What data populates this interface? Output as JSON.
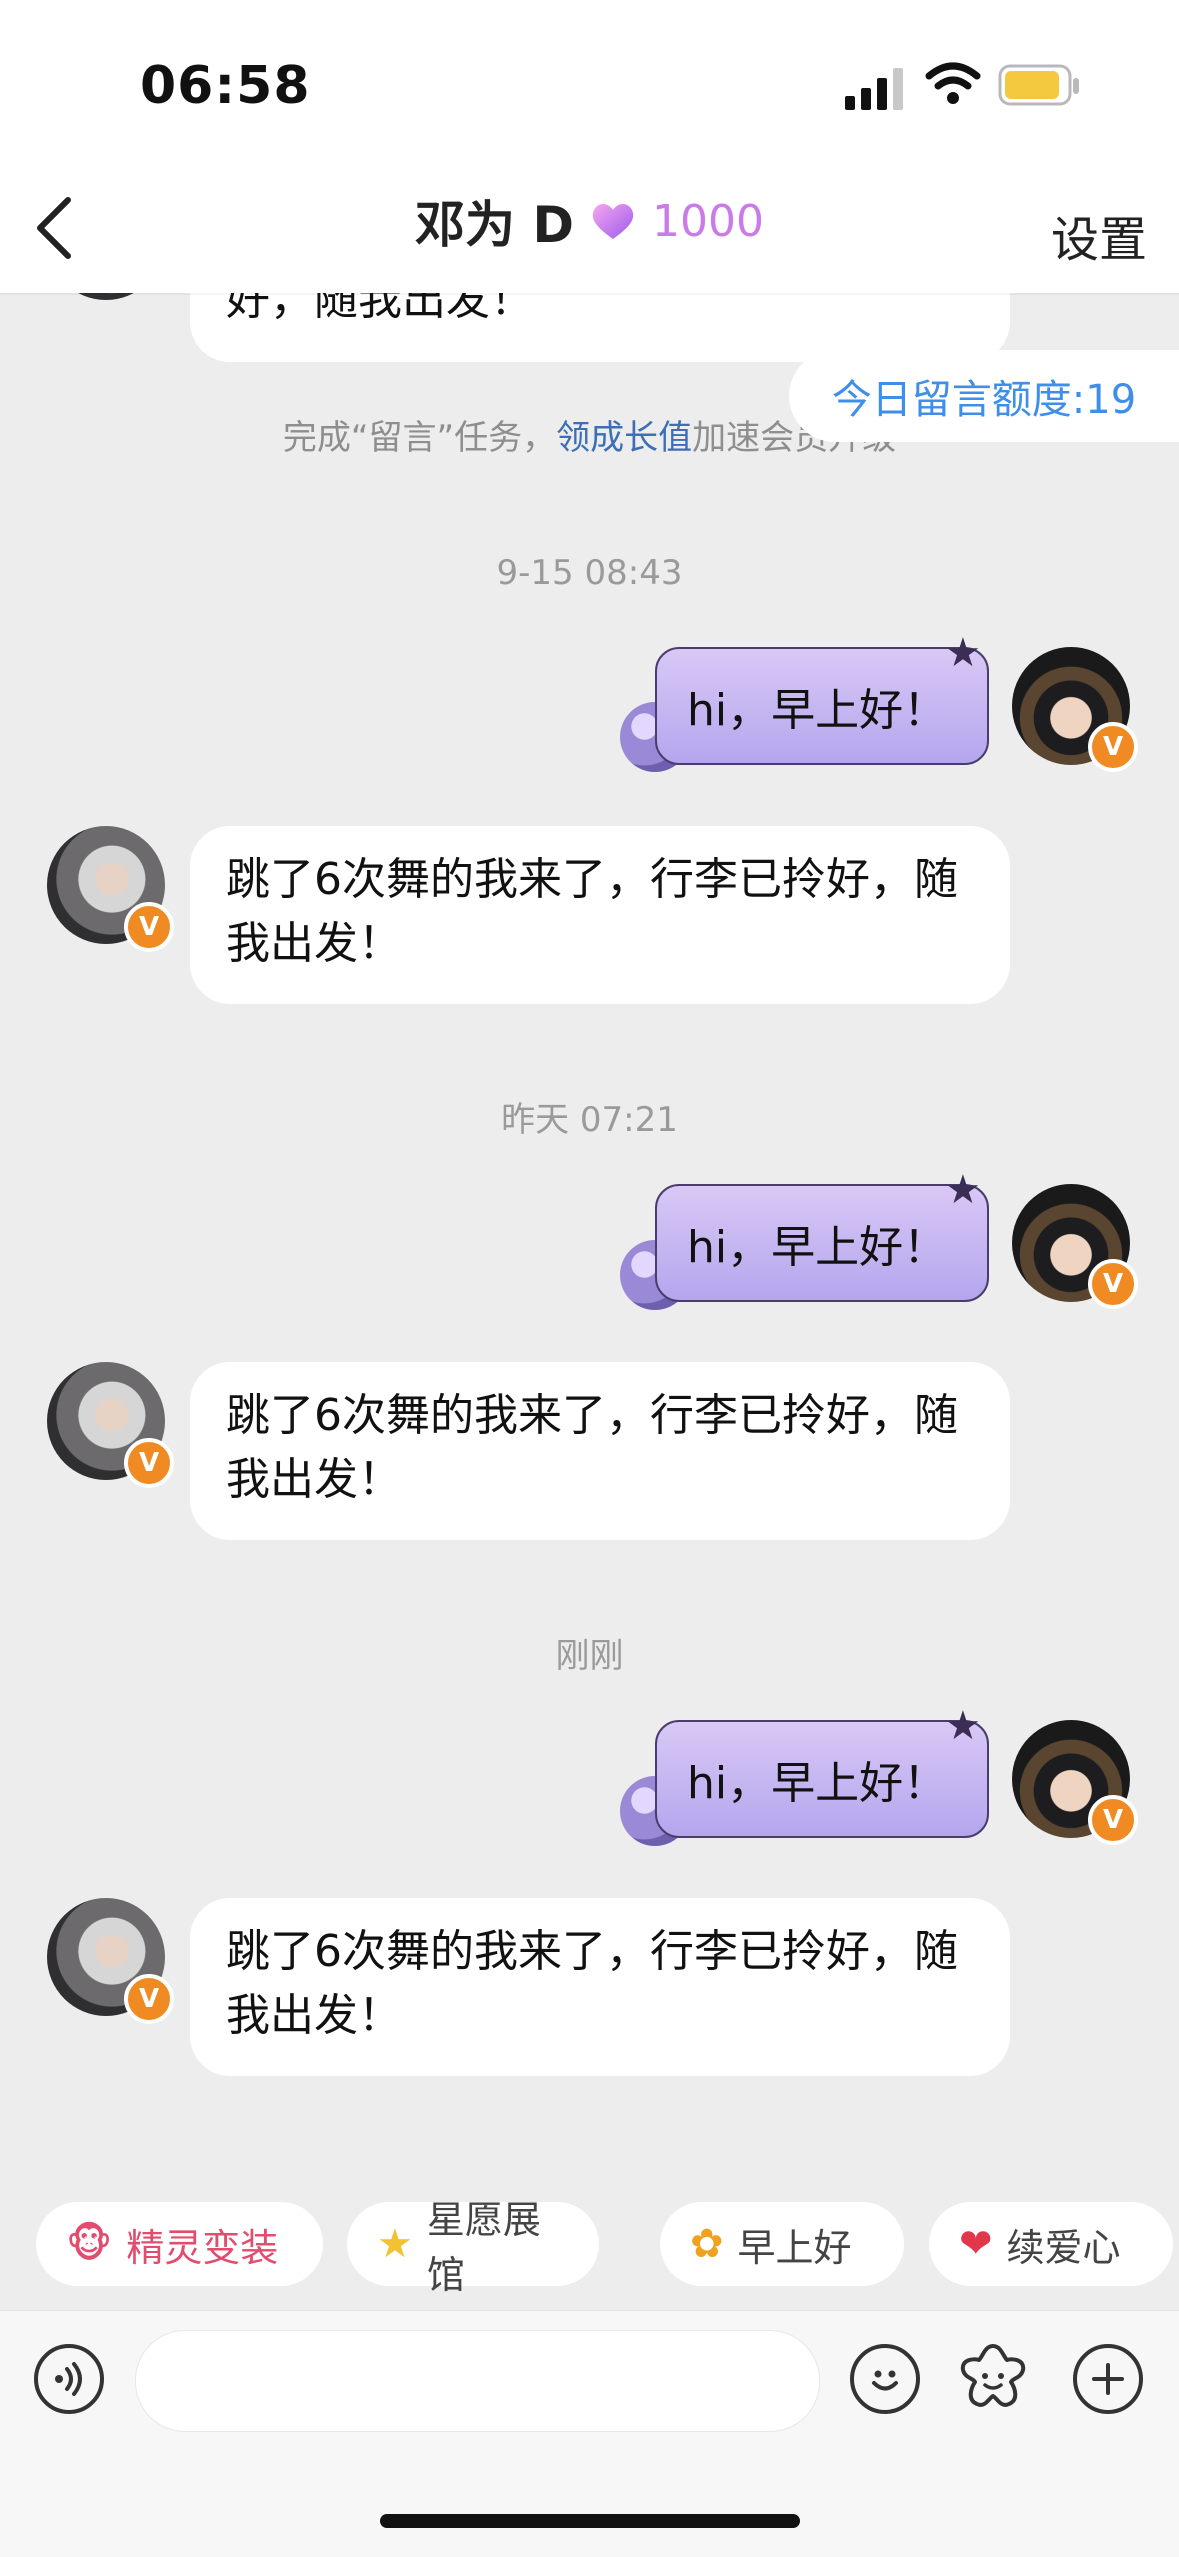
{
  "status_bar": {
    "time": "06:58"
  },
  "header": {
    "title": "邓为 D",
    "heart_count": "1000",
    "settings_label": "设置",
    "back_icon": "chevron-left-icon"
  },
  "banner": {
    "tip_prefix": "完成“留言”任务，",
    "tip_link": "领成长值",
    "tip_suffix": "加速会员升级",
    "quota_label": "今日留言额度:19"
  },
  "conversation": {
    "partial_incoming_text": "好，随我出发！",
    "groups": [
      {
        "timestamp": "9-15 08:43",
        "outgoing": "hi，早上好！",
        "incoming": "跳了6次舞的我来了，行李已拎好，随我出发！"
      },
      {
        "timestamp": "昨天 07:21",
        "outgoing": "hi，早上好！",
        "incoming": "跳了6次舞的我来了，行李已拎好，随我出发！"
      },
      {
        "timestamp": "刚刚",
        "outgoing": "hi，早上好！",
        "incoming": "跳了6次舞的我来了，行李已拎好，随我出发！"
      }
    ],
    "badge_letter": "V"
  },
  "quick_replies": [
    {
      "label": "精灵变装",
      "icon": "sprite-icon",
      "color": "#E24C6D"
    },
    {
      "label": "星愿展馆",
      "icon": "star-icon",
      "color": "#444444"
    },
    {
      "label": "早上好",
      "icon": "sunflower-icon",
      "color": "#444444"
    },
    {
      "label": "续爱心",
      "icon": "heart-icon",
      "color": "#444444"
    }
  ],
  "input_bar": {
    "voice_icon": "voice-icon",
    "emoji_icon": "emoji-icon",
    "sticker_icon": "flower-icon",
    "plus_icon": "plus-icon"
  },
  "colors": {
    "background": "#EDEDED",
    "accent_purple": "#C97BE8",
    "link_blue": "#3C6FB5",
    "quota_blue": "#3E8EEA",
    "badge_orange": "#F08A22"
  }
}
